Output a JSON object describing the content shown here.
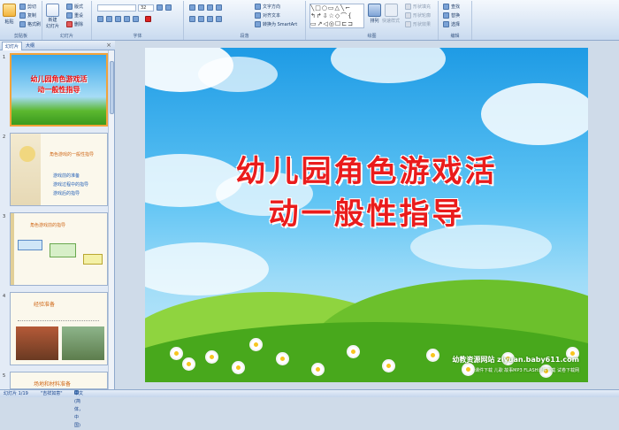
{
  "ribbon": {
    "groups": {
      "clipboard": "剪贴板",
      "slides": "幻灯片",
      "font": "字体",
      "paragraph": "段落",
      "drawing": "绘图",
      "editing": "编辑"
    },
    "clipboard": {
      "paste": "粘贴",
      "cut": "剪切",
      "copy": "复制",
      "format_painter": "格式刷"
    },
    "slides": {
      "new_slide": "新建",
      "new_slide2": "幻灯片",
      "layout": "版式",
      "reset": "重设",
      "delete": "删除"
    },
    "font": {
      "font_name": "",
      "font_size": "32"
    },
    "paragraph": {
      "text_direction": "文字方向",
      "align_text": "对齐文本",
      "smartart": "转换为 SmartArt"
    },
    "drawing": {
      "arrange": "排列",
      "quick_styles": "快速样式",
      "fill": "形状填充",
      "outline": "形状轮廓",
      "effects": "形状效果"
    },
    "editing": {
      "find": "查找",
      "replace": "替换",
      "select": "选择"
    }
  },
  "panel": {
    "tab_slides": "幻灯片",
    "tab_outline": "大纲",
    "close": "×",
    "thumbs": [
      {
        "num": "1",
        "title1": "幼儿园角色游戏活",
        "title2": "动一般性指导"
      },
      {
        "num": "2",
        "heading": "角色游戏的一般性指导",
        "items": [
          "游戏前的准备",
          "游戏过程中的指导",
          "游戏后的指导"
        ]
      },
      {
        "num": "3",
        "heading": "角色游戏前的指导"
      },
      {
        "num": "4",
        "heading": "经验准备"
      },
      {
        "num": "5",
        "heading": "场地和材料准备"
      }
    ]
  },
  "slide": {
    "title_line1": "幼儿园角色游戏活",
    "title_line2": "动一般性指导",
    "watermark": "幼教资源网站 ziyuan.baby611.com",
    "watermark_sub": "课件下载 儿歌 故事MP3 FLASH课件下载 试卷下载网"
  },
  "status": {
    "slide_info": "幻灯片 1/19",
    "theme": "\"吉祥如意\"",
    "language": "中文(简体，中国)"
  },
  "colors": {
    "title": "#ea1c1c",
    "selection": "#f2a33a"
  }
}
